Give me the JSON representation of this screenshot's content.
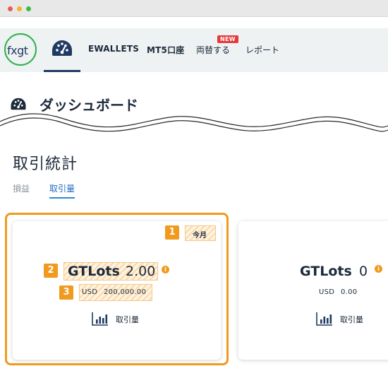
{
  "nav": {
    "logo_text": "fxgt",
    "items": [
      {
        "label": "EWALLETS"
      },
      {
        "label": "MT5口座"
      },
      {
        "label": "両替する",
        "badge": "NEW"
      },
      {
        "label": "レポート"
      }
    ]
  },
  "page": {
    "title": "ダッシュボード",
    "section_title": "取引統計",
    "tabs": [
      {
        "label": "損益",
        "active": false
      },
      {
        "label": "取引量",
        "active": true
      }
    ]
  },
  "cards": [
    {
      "period": "今月",
      "lots_label": "GTLots",
      "lots_value": "2.00",
      "info": "i",
      "usd_label": "USD",
      "usd_value": "200,000.00",
      "volume_label": "取引量"
    },
    {
      "lots_label": "GTLots",
      "lots_value": "0",
      "info": "i",
      "usd_label": "USD",
      "usd_value": "0.00",
      "volume_label": "取引量"
    }
  ],
  "markers": [
    "1",
    "2",
    "3"
  ],
  "colors": {
    "accent_orange": "#f09a1e",
    "navy": "#1f3a63",
    "logo_green": "#2fb04a",
    "new_badge": "#e63a3a",
    "active_tab_blue": "#2e89d6"
  },
  "icons": {
    "dashboard": "speedometer-icon",
    "volume": "bar-chart-icon",
    "info": "info-icon"
  }
}
